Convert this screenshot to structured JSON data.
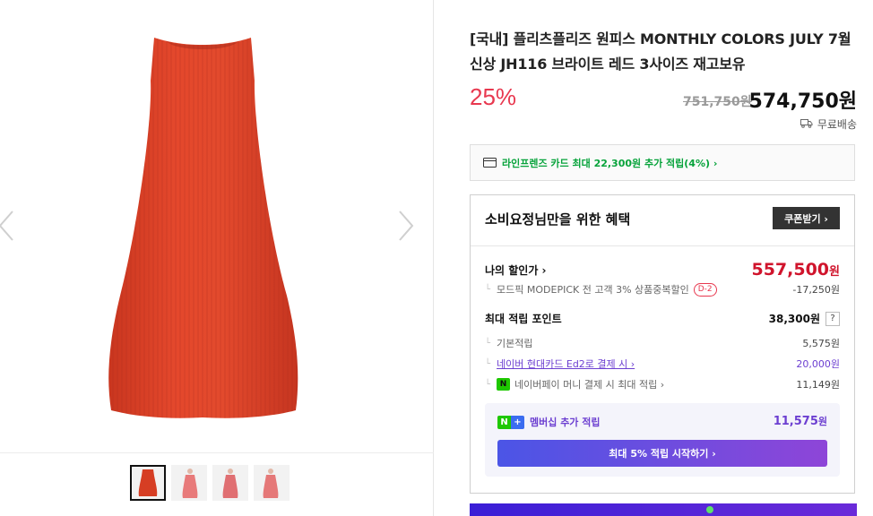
{
  "product": {
    "title": "[국내] 플리츠플리즈 원피스 MONTHLY COLORS JULY 7월 신상 JH116 브라이트 레드 3사이즈 재고보유",
    "discount": "25%",
    "original_price": "751,750원",
    "sale_price": "574,750원",
    "shipping": "무료배송"
  },
  "card_promo": {
    "text": "라인프렌즈 카드 최대 22,300원 추가 적립(4%) ›"
  },
  "benefit": {
    "heading": "소비요정님만을 위한 혜택",
    "coupon_button": "쿠폰받기 ›",
    "my_price_label": "나의 할인가 ›",
    "my_price_value": "557,500",
    "my_price_unit": "원",
    "coupon_line": "모드픽 MODEPICK 전 고객 3% 상품중복할인",
    "coupon_dday": "D-2",
    "coupon_amount": "-17,250원",
    "points_label": "최대 적립 포인트",
    "points_value": "38,300원",
    "help": "?",
    "basic_label": "기본적립",
    "basic_value": "5,575원",
    "naver_card_label": "네이버 현대카드 Ed2로 결제 시 ›",
    "naver_card_value": "20,000원",
    "npay_label": "네이버페이 머니 결제 시 최대 적립 ›",
    "npay_value": "11,149원",
    "membership_label": "멤버십 추가 적립",
    "membership_value": "11,575",
    "membership_unit": "원",
    "start_button": "최대 5% 적립 시작하기 ›"
  },
  "icons": {
    "prev": "chevron-left-icon",
    "next": "chevron-right-icon",
    "shipping": "truck-icon",
    "card": "credit-card-icon",
    "npay": "naver-pay-icon",
    "membership": "naver-plus-icon"
  },
  "colors": {
    "discount": "#e8384f",
    "my_price": "#d0142c",
    "card_promo": "#07a33b",
    "membership": "#6c3fd1",
    "dress": "#e0452a"
  }
}
